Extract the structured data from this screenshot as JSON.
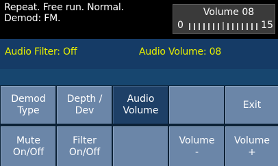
{
  "status": {
    "line1": "Repeat. Free run. Normal.",
    "line2": "Demod: FM."
  },
  "volume_panel": {
    "title": "Volume 08",
    "min": "0",
    "max": "15",
    "level": 8,
    "max_level": 15
  },
  "info": {
    "audio_filter": "Audio Filter: Off",
    "audio_volume": "Audio Volume: 08"
  },
  "softkeys": [
    {
      "label": "Demod\nType",
      "active": false
    },
    {
      "label": "Depth /\nDev",
      "active": false
    },
    {
      "label": "Audio\nVolume",
      "active": true
    },
    {
      "label": "",
      "active": false
    },
    {
      "label": "Exit",
      "active": false
    },
    {
      "label": "Mute\nOn/Off",
      "active": false
    },
    {
      "label": "Filter\nOn/Off",
      "active": false
    },
    {
      "label": "",
      "active": false
    },
    {
      "label": "Volume\n-",
      "active": false
    },
    {
      "label": "Volume\n+",
      "active": false
    }
  ],
  "colors": {
    "info_text": "#e9f000",
    "key_bg": "#6b86a8",
    "key_active_bg": "#1e4067",
    "info_bg": "#153b66"
  }
}
